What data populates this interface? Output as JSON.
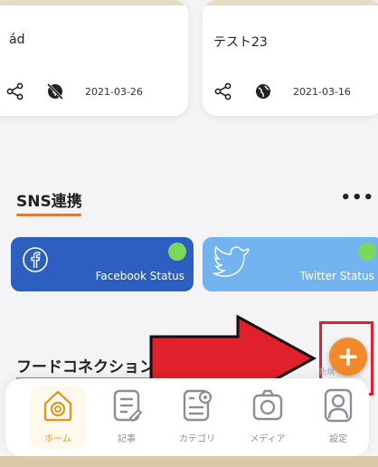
{
  "cards": [
    {
      "title": "ád",
      "date": "2021-03-26",
      "icons": [
        "share-icon",
        "globe-off-icon"
      ]
    },
    {
      "title": "テスト23",
      "date": "2021-03-16",
      "icons": [
        "share-icon",
        "globe-icon"
      ]
    }
  ],
  "sns_section": {
    "title": "SNS連携",
    "more": "•••",
    "facebook": {
      "label": "Facebook Status",
      "color": "#2d5fc0",
      "status_color": "#7bd85c"
    },
    "twitter": {
      "label": "Twitter Status",
      "color": "#73b3ef",
      "status_color": "#7bd85c"
    }
  },
  "feed_section": {
    "title": "フードコネクションか"
  },
  "fab": {
    "symbol": "+",
    "label": "新規"
  },
  "nav": {
    "items": [
      {
        "label": "ホーム",
        "icon": "home-icon",
        "active": true
      },
      {
        "label": "記事",
        "icon": "article-icon",
        "active": false
      },
      {
        "label": "カテゴリ",
        "icon": "category-icon",
        "active": false
      },
      {
        "label": "メディア",
        "icon": "camera-icon",
        "active": false
      },
      {
        "label": "設定",
        "icon": "user-settings-icon",
        "active": false
      }
    ]
  },
  "annotation": {
    "arrow_color": "#e0202a"
  }
}
